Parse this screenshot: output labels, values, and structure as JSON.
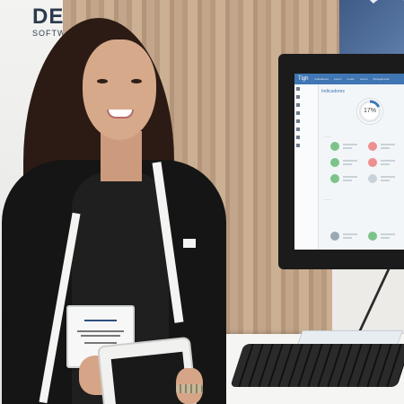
{
  "scene": {
    "description_free": true
  },
  "booth_sign": {
    "brand_text": "DES",
    "brand_subtext": "SOFTW"
  },
  "monitor": {
    "app_logo": "Tigh",
    "nav_items": [
      "Indicadores",
      "Lorem",
      "Lorem",
      "Lorem",
      "Planejamento"
    ],
    "section_title": "Indicadores",
    "gauge_value": "17%",
    "colors": {
      "topbar": "#3f76b3",
      "tile_green": "#7cc38a",
      "tile_red": "#ef8f8f",
      "tile_gray": "#9aa8b3"
    }
  },
  "badge": {
    "logo_icon": "conference-logo-icon"
  }
}
